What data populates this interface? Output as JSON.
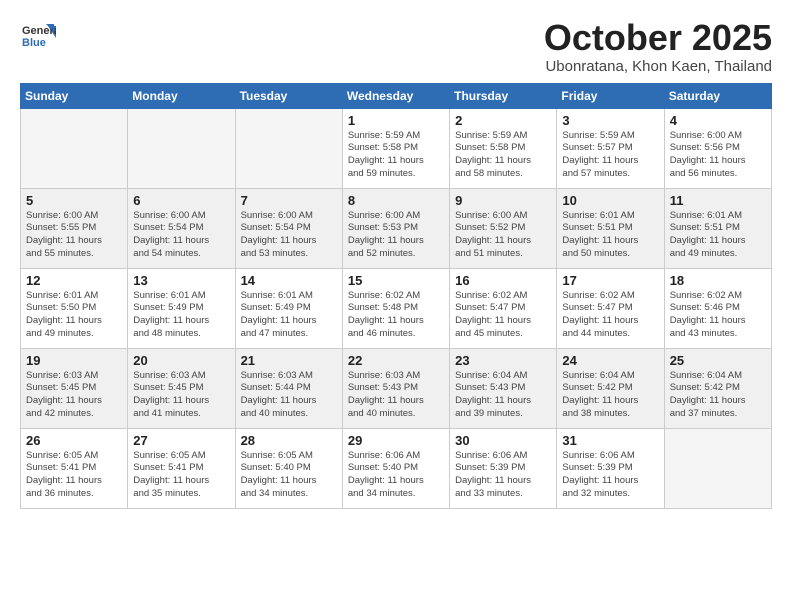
{
  "header": {
    "logo": {
      "general": "General",
      "blue": "Blue"
    },
    "title": "October 2025",
    "location": "Ubonratana, Khon Kaen, Thailand"
  },
  "weekdays": [
    "Sunday",
    "Monday",
    "Tuesday",
    "Wednesday",
    "Thursday",
    "Friday",
    "Saturday"
  ],
  "weeks": [
    [
      {
        "day": null,
        "info": null
      },
      {
        "day": null,
        "info": null
      },
      {
        "day": null,
        "info": null
      },
      {
        "day": "1",
        "info": "Sunrise: 5:59 AM\nSunset: 5:58 PM\nDaylight: 11 hours\nand 59 minutes."
      },
      {
        "day": "2",
        "info": "Sunrise: 5:59 AM\nSunset: 5:58 PM\nDaylight: 11 hours\nand 58 minutes."
      },
      {
        "day": "3",
        "info": "Sunrise: 5:59 AM\nSunset: 5:57 PM\nDaylight: 11 hours\nand 57 minutes."
      },
      {
        "day": "4",
        "info": "Sunrise: 6:00 AM\nSunset: 5:56 PM\nDaylight: 11 hours\nand 56 minutes."
      }
    ],
    [
      {
        "day": "5",
        "info": "Sunrise: 6:00 AM\nSunset: 5:55 PM\nDaylight: 11 hours\nand 55 minutes."
      },
      {
        "day": "6",
        "info": "Sunrise: 6:00 AM\nSunset: 5:54 PM\nDaylight: 11 hours\nand 54 minutes."
      },
      {
        "day": "7",
        "info": "Sunrise: 6:00 AM\nSunset: 5:54 PM\nDaylight: 11 hours\nand 53 minutes."
      },
      {
        "day": "8",
        "info": "Sunrise: 6:00 AM\nSunset: 5:53 PM\nDaylight: 11 hours\nand 52 minutes."
      },
      {
        "day": "9",
        "info": "Sunrise: 6:00 AM\nSunset: 5:52 PM\nDaylight: 11 hours\nand 51 minutes."
      },
      {
        "day": "10",
        "info": "Sunrise: 6:01 AM\nSunset: 5:51 PM\nDaylight: 11 hours\nand 50 minutes."
      },
      {
        "day": "11",
        "info": "Sunrise: 6:01 AM\nSunset: 5:51 PM\nDaylight: 11 hours\nand 49 minutes."
      }
    ],
    [
      {
        "day": "12",
        "info": "Sunrise: 6:01 AM\nSunset: 5:50 PM\nDaylight: 11 hours\nand 49 minutes."
      },
      {
        "day": "13",
        "info": "Sunrise: 6:01 AM\nSunset: 5:49 PM\nDaylight: 11 hours\nand 48 minutes."
      },
      {
        "day": "14",
        "info": "Sunrise: 6:01 AM\nSunset: 5:49 PM\nDaylight: 11 hours\nand 47 minutes."
      },
      {
        "day": "15",
        "info": "Sunrise: 6:02 AM\nSunset: 5:48 PM\nDaylight: 11 hours\nand 46 minutes."
      },
      {
        "day": "16",
        "info": "Sunrise: 6:02 AM\nSunset: 5:47 PM\nDaylight: 11 hours\nand 45 minutes."
      },
      {
        "day": "17",
        "info": "Sunrise: 6:02 AM\nSunset: 5:47 PM\nDaylight: 11 hours\nand 44 minutes."
      },
      {
        "day": "18",
        "info": "Sunrise: 6:02 AM\nSunset: 5:46 PM\nDaylight: 11 hours\nand 43 minutes."
      }
    ],
    [
      {
        "day": "19",
        "info": "Sunrise: 6:03 AM\nSunset: 5:45 PM\nDaylight: 11 hours\nand 42 minutes."
      },
      {
        "day": "20",
        "info": "Sunrise: 6:03 AM\nSunset: 5:45 PM\nDaylight: 11 hours\nand 41 minutes."
      },
      {
        "day": "21",
        "info": "Sunrise: 6:03 AM\nSunset: 5:44 PM\nDaylight: 11 hours\nand 40 minutes."
      },
      {
        "day": "22",
        "info": "Sunrise: 6:03 AM\nSunset: 5:43 PM\nDaylight: 11 hours\nand 40 minutes."
      },
      {
        "day": "23",
        "info": "Sunrise: 6:04 AM\nSunset: 5:43 PM\nDaylight: 11 hours\nand 39 minutes."
      },
      {
        "day": "24",
        "info": "Sunrise: 6:04 AM\nSunset: 5:42 PM\nDaylight: 11 hours\nand 38 minutes."
      },
      {
        "day": "25",
        "info": "Sunrise: 6:04 AM\nSunset: 5:42 PM\nDaylight: 11 hours\nand 37 minutes."
      }
    ],
    [
      {
        "day": "26",
        "info": "Sunrise: 6:05 AM\nSunset: 5:41 PM\nDaylight: 11 hours\nand 36 minutes."
      },
      {
        "day": "27",
        "info": "Sunrise: 6:05 AM\nSunset: 5:41 PM\nDaylight: 11 hours\nand 35 minutes."
      },
      {
        "day": "28",
        "info": "Sunrise: 6:05 AM\nSunset: 5:40 PM\nDaylight: 11 hours\nand 34 minutes."
      },
      {
        "day": "29",
        "info": "Sunrise: 6:06 AM\nSunset: 5:40 PM\nDaylight: 11 hours\nand 34 minutes."
      },
      {
        "day": "30",
        "info": "Sunrise: 6:06 AM\nSunset: 5:39 PM\nDaylight: 11 hours\nand 33 minutes."
      },
      {
        "day": "31",
        "info": "Sunrise: 6:06 AM\nSunset: 5:39 PM\nDaylight: 11 hours\nand 32 minutes."
      },
      {
        "day": null,
        "info": null
      }
    ]
  ]
}
